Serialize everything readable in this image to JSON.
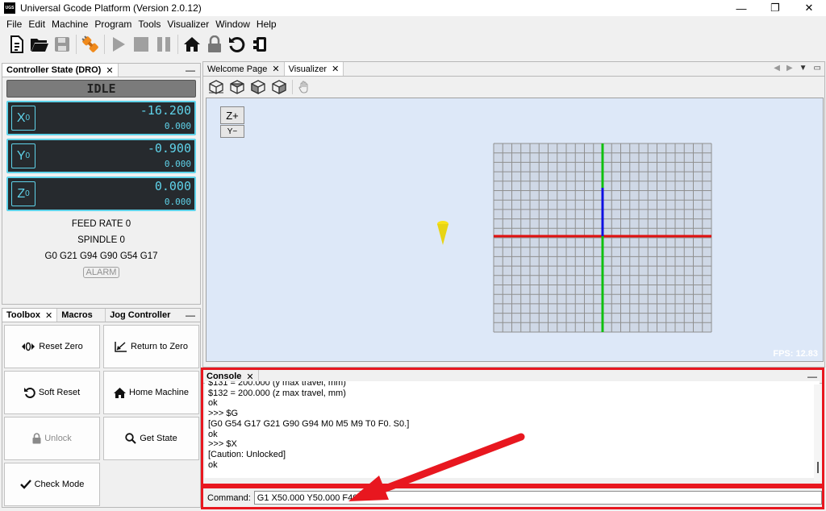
{
  "window": {
    "title": "Universal Gcode Platform (Version 2.0.12)",
    "logo_text": "UGS",
    "minimize": "—",
    "restore": "❐",
    "close": "✕"
  },
  "menu": [
    "File",
    "Edit",
    "Machine",
    "Program",
    "Tools",
    "Visualizer",
    "Window",
    "Help"
  ],
  "dro": {
    "tab_label": "Controller State (DRO)",
    "state": "IDLE",
    "axes": [
      {
        "axis": "X",
        "sub": "0",
        "work": "-16.200",
        "machine": "0.000"
      },
      {
        "axis": "Y",
        "sub": "0",
        "work": "-0.900",
        "machine": "0.000"
      },
      {
        "axis": "Z",
        "sub": "0",
        "work": "0.000",
        "machine": "0.000"
      }
    ],
    "feed_rate": "FEED RATE 0",
    "spindle": "SPINDLE 0",
    "gcode_state": "G0 G21 G94 G90 G54 G17",
    "alarm": "ALARM"
  },
  "toolbox": {
    "tabs": [
      "Toolbox",
      "Macros",
      "Jog Controller"
    ],
    "buttons": [
      {
        "label": "Reset Zero",
        "icon": "reset-zero-icon"
      },
      {
        "label": "Return to Zero",
        "icon": "return-to-zero-icon"
      },
      {
        "label": "Soft Reset",
        "icon": "soft-reset-icon"
      },
      {
        "label": "Home Machine",
        "icon": "home-icon"
      },
      {
        "label": "Unlock",
        "icon": "lock-icon"
      },
      {
        "label": "Get State",
        "icon": "search-icon"
      },
      {
        "label": "Check Mode",
        "icon": "check-icon"
      }
    ]
  },
  "editor_tabs": [
    "Welcome Page",
    "Visualizer"
  ],
  "visualizer": {
    "z_plus": "Z+",
    "y_minus": "Y−",
    "fps": "FPS: 12.83"
  },
  "console": {
    "tab_label": "Console",
    "lines": [
      "$131 = 200.000    (y max travel, mm)",
      "$132 = 200.000    (z max travel, mm)",
      "ok",
      ">>> $G",
      "[G0 G54 G17 G21 G90 G94 M0 M5 M9 T0 F0. S0.]",
      "ok",
      ">>> $X",
      "[Caution: Unlocked]",
      "ok"
    ]
  },
  "command": {
    "label": "Command:",
    "value": "G1 X50.000 Y50.000 F400"
  },
  "colors": {
    "highlight": "#e8171f",
    "dro_cyan": "#5fd3ea",
    "x_axis": "#e01010",
    "y_axis": "#10c010",
    "z_axis": "#1010e0"
  }
}
